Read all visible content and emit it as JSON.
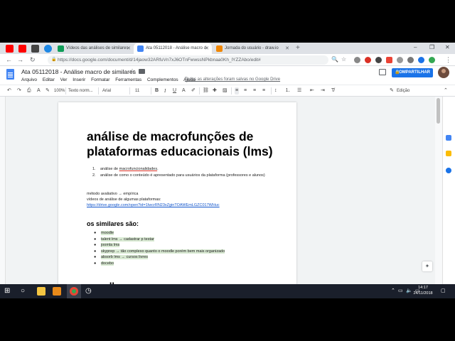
{
  "browser": {
    "tabs": [
      {
        "label": "Vídeos das análises de similares"
      },
      {
        "label": "Ata 05112018 - Análise macro d"
      },
      {
        "label": "Jornada do usuário - draw.io"
      }
    ],
    "url": "https://docs.google.com/document/d/14jaow32ARfuVn7xJ6OTnFwwssNPkbnaa0Kh_lYZZAbo/edit#",
    "new_tab": "+",
    "controls": {
      "minimize": "–",
      "maximize": "❐",
      "close": "✕"
    }
  },
  "docs": {
    "title": "Ata 05112018 - Análise macro de similares",
    "menu": [
      "Arquivo",
      "Editar",
      "Ver",
      "Inserir",
      "Formatar",
      "Ferramentas",
      "Complementos",
      "Ajuda"
    ],
    "saved_note": "Todas as alterações foram salvas no Google Drive",
    "share_label": "COMPARTILHAR",
    "toolbar": {
      "zoom": "100%",
      "style": "Texto norm...",
      "font": "Arial",
      "size": "11",
      "mode": "Edição"
    }
  },
  "document": {
    "heading": "análise de macrofunções de plataformas educacionais (lms)",
    "ordered": [
      {
        "num": "1.",
        "pre": "análise de ",
        "mark": "macrofuncionalidades",
        "post": "."
      },
      {
        "num": "2.",
        "pre": "análise de como o conteúdo é apresentado para usuários da plataforma (professores e alunos)",
        "mark": "",
        "post": ""
      }
    ],
    "method_line": "método avaliativo → empírica",
    "videos_line": "vídeos de análise de algumas plataformas:",
    "videos_link": "https://drive.google.com/open?id=1IwcrRN23xZginTOAWEmLGZC017WHuc",
    "similares_heading": "os similares são:",
    "similares": [
      "moodle",
      "talent lms → cadastrar p testar",
      "joomla lms",
      "skyprep → tão complexo quanto o moodle porém bem mais organizado",
      "absorb lms → cursos livres",
      "docebo"
    ],
    "next_heading": "moodle"
  },
  "taskbar": {
    "time": "14:17",
    "date": "24/11/2018"
  },
  "colors": {
    "accent": "#1a73e8",
    "docs_blue": "#4285f4",
    "highlight": "#d9ead3",
    "taskbar": "#1a1f2b"
  }
}
